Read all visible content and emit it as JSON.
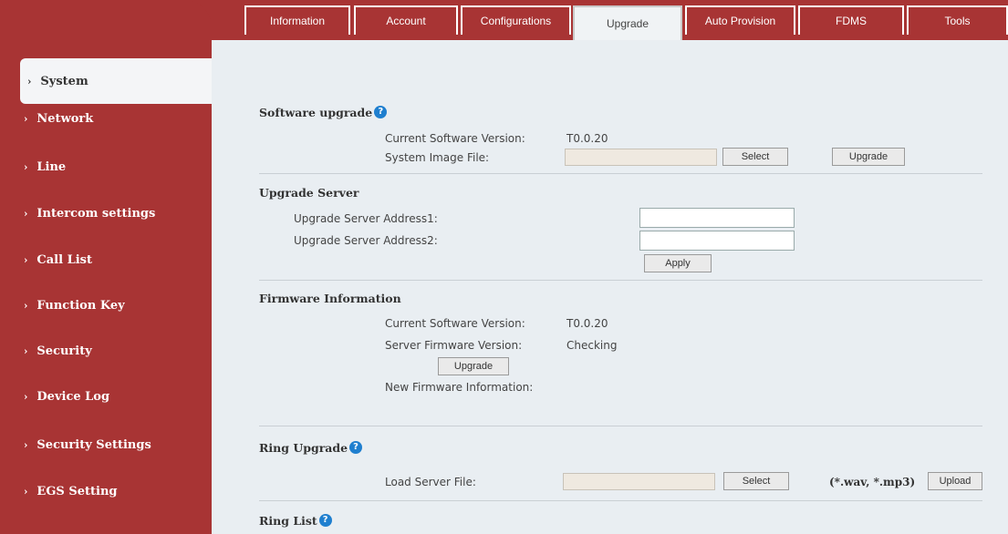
{
  "tabs": [
    "Information",
    "Account",
    "Configurations",
    "Upgrade",
    "Auto Provision",
    "FDMS",
    "Tools"
  ],
  "sidebar": {
    "items": [
      "System",
      "Network",
      "Line",
      "Intercom settings",
      "Call List",
      "Function Key",
      "Security",
      "Device Log",
      "Security Settings",
      "EGS Setting"
    ]
  },
  "software_upgrade": {
    "title": "Software upgrade",
    "current_version_label": "Current Software Version:",
    "current_version_value": "T0.0.20",
    "system_image_label": "System Image File:",
    "select_label": "Select",
    "upgrade_label": "Upgrade"
  },
  "upgrade_server": {
    "title": "Upgrade Server",
    "address1_label": "Upgrade Server Address1:",
    "address2_label": "Upgrade Server Address2:",
    "address1_value": "",
    "address2_value": "",
    "apply_label": "Apply"
  },
  "firmware_info": {
    "title": "Firmware Information",
    "current_version_label": "Current Software Version:",
    "current_version_value": "T0.0.20",
    "server_version_label": "Server Firmware Version:",
    "server_version_value": "Checking",
    "upgrade_label": "Upgrade",
    "new_firmware_label": "New Firmware Information:"
  },
  "ring_upgrade": {
    "title": "Ring Upgrade",
    "load_label": "Load Server File:",
    "select_label": "Select",
    "formats": "(*.wav, *.mp3)",
    "upload_label": "Upload"
  },
  "ring_list": {
    "title": "Ring List"
  },
  "colors": {
    "brand": "#a83434",
    "help": "#1f7fcf",
    "content_bg": "#e9eef2"
  }
}
